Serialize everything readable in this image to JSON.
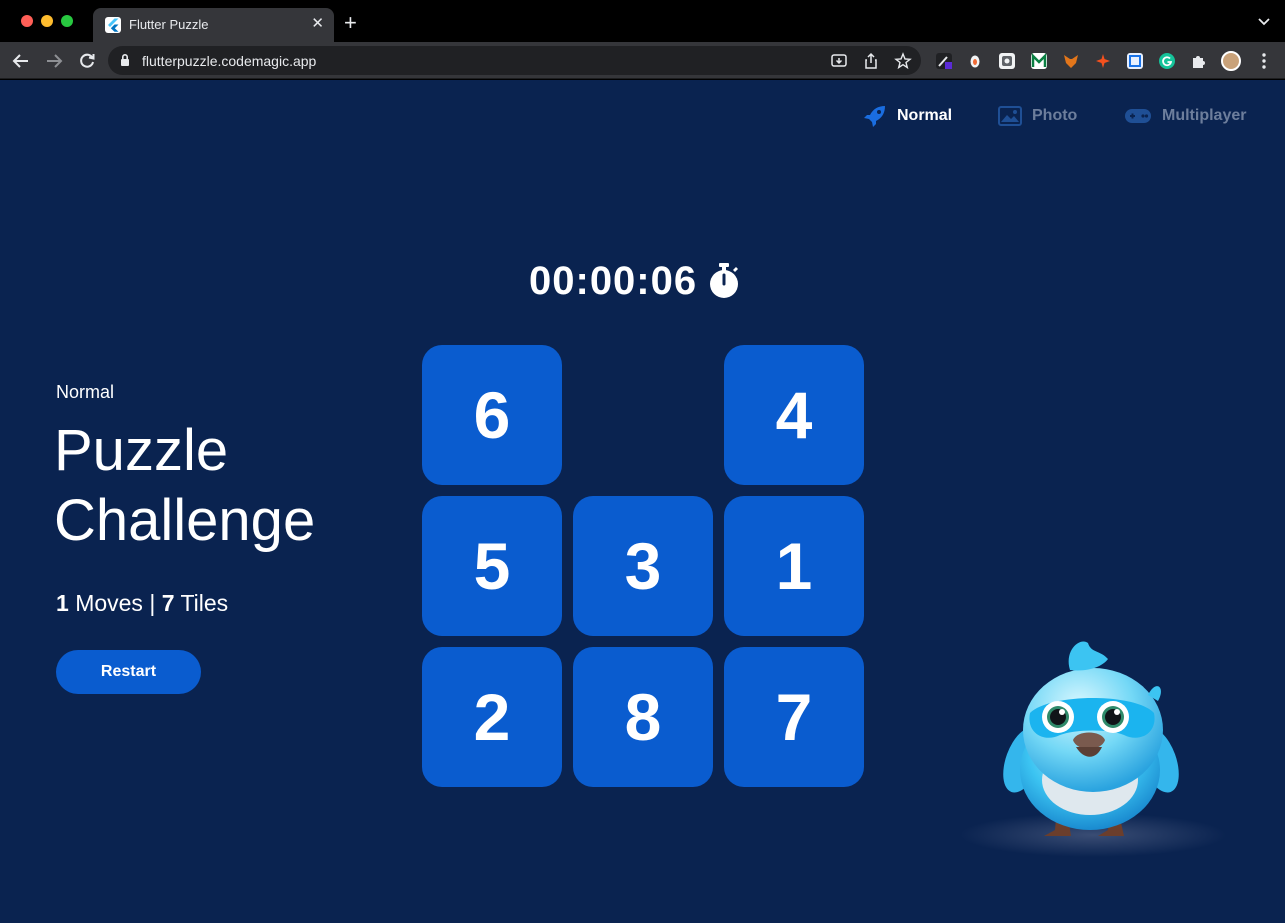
{
  "browser": {
    "tab_title": "Flutter Puzzle",
    "url": "flutterpuzzle.codemagic.app"
  },
  "menu": {
    "normal": "Normal",
    "photo": "Photo",
    "multiplayer": "Multiplayer",
    "active": "Normal"
  },
  "timer": {
    "value": "00:00:06"
  },
  "info": {
    "mode": "Normal",
    "title": "Puzzle Challenge",
    "moves_count": "1",
    "moves_label": "Moves |",
    "tiles_count": "7",
    "tiles_label": "Tiles",
    "restart_label": "Restart"
  },
  "board": {
    "rows": [
      [
        "6",
        "",
        "4"
      ],
      [
        "5",
        "3",
        "1"
      ],
      [
        "2",
        "8",
        "7"
      ]
    ]
  },
  "colors": {
    "background": "#0a2350",
    "tile": "#0a5ccf",
    "menu_inactive": "#6d7e9c"
  }
}
